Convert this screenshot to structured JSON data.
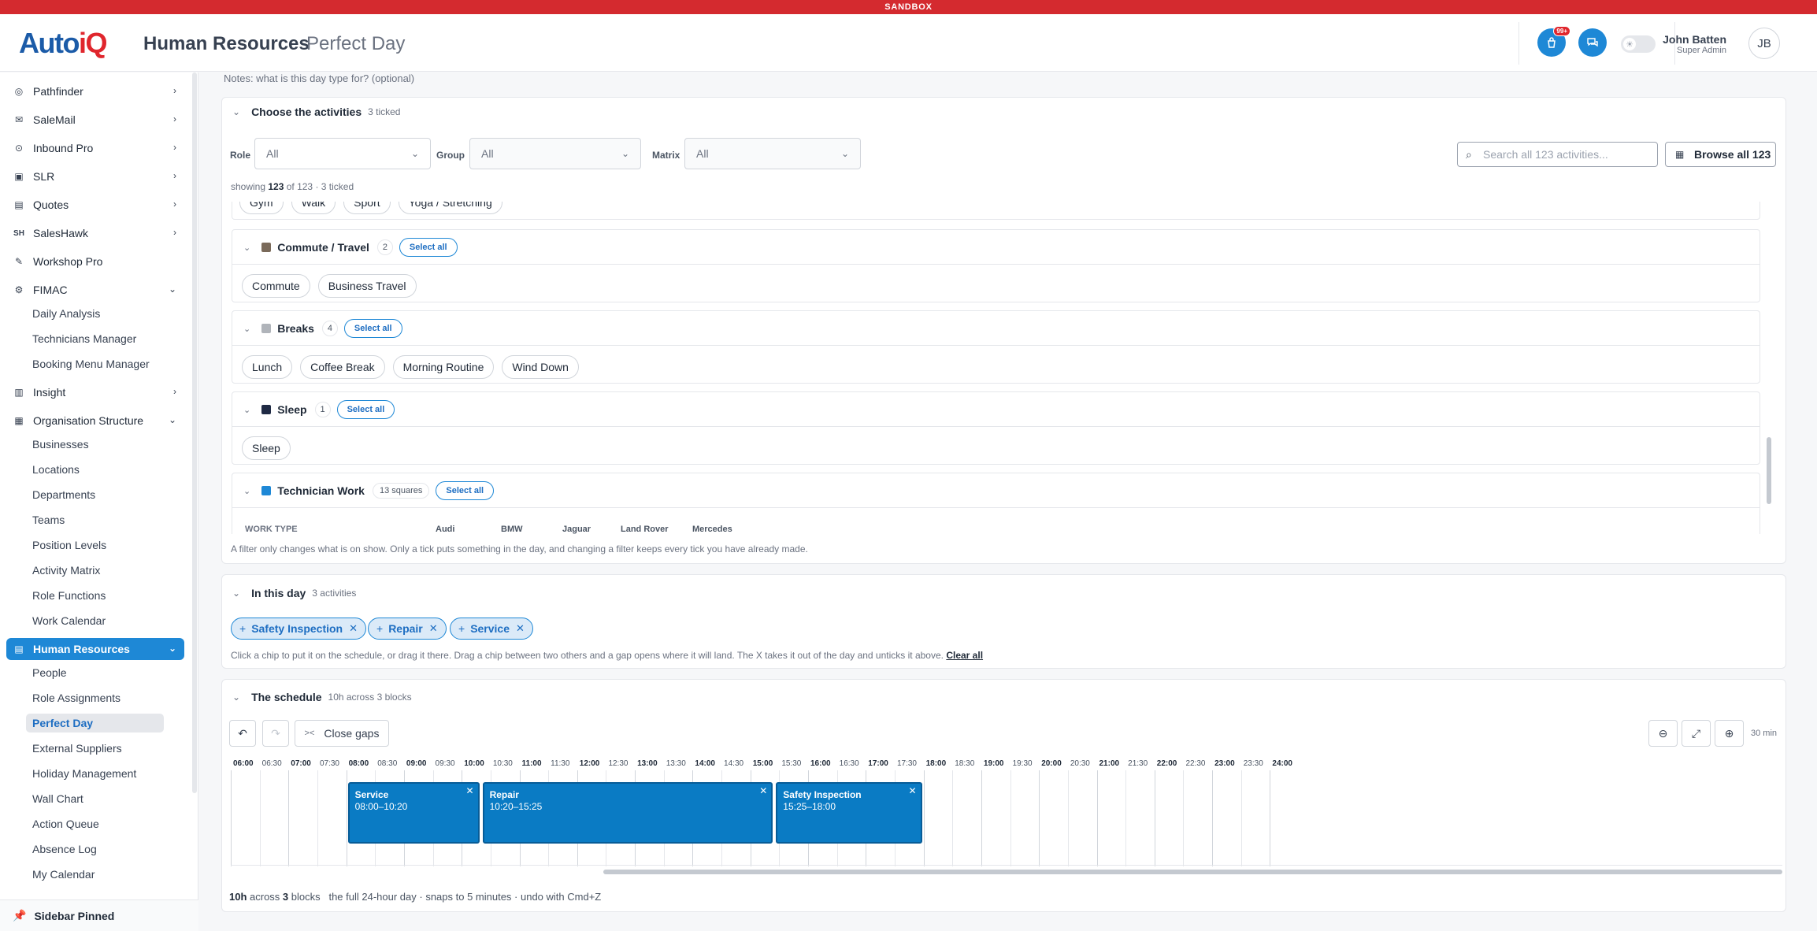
{
  "banner": "SANDBOX",
  "header": {
    "logo_a": "Auto",
    "logo_b": "iQ",
    "title": "Human Resources",
    "subtitle": "Perfect Day",
    "badge": "99+",
    "user_name": "John Batten",
    "user_role": "Super Admin",
    "avatar": "JB"
  },
  "sidebar": {
    "items": [
      {
        "label": "Pathfinder",
        "icon": "compass-icon"
      },
      {
        "label": "SaleMail",
        "icon": "salemail-icon"
      },
      {
        "label": "Inbound Pro",
        "icon": "inbound-icon"
      },
      {
        "label": "SLR",
        "icon": "slr-icon"
      },
      {
        "label": "Quotes",
        "icon": "quotes-icon"
      },
      {
        "label": "SalesHawk",
        "icon": "saleshawk-icon"
      },
      {
        "label": "Workshop Pro",
        "icon": "workshop-icon"
      },
      {
        "label": "FIMAC",
        "icon": "fimac-icon"
      },
      {
        "label": "Insight",
        "icon": "chart-icon"
      },
      {
        "label": "Organisation Structure",
        "icon": "org-icon"
      },
      {
        "label": "Human Resources",
        "icon": "hr-icon"
      }
    ],
    "fimac_sub": [
      "Daily Analysis",
      "Technicians Manager",
      "Booking Menu Manager"
    ],
    "org_sub": [
      "Businesses",
      "Locations",
      "Departments",
      "Teams",
      "Position Levels",
      "Activity Matrix",
      "Role Functions",
      "Work Calendar"
    ],
    "hr_sub": [
      "People",
      "Role Assignments",
      "Perfect Day",
      "External Suppliers",
      "Holiday Management",
      "Wall Chart",
      "Action Queue",
      "Absence Log",
      "My Calendar"
    ],
    "pinned": "Sidebar Pinned"
  },
  "notes": "Notes: what is this day type for? (optional)",
  "activities": {
    "title": "Choose the activities",
    "count": "3 ticked",
    "filters": {
      "role_label": "Role",
      "role_value": "All",
      "group_label": "Group",
      "group_value": "All",
      "matrix_label": "Matrix",
      "matrix_value": "All"
    },
    "search_placeholder": "Search all 123 activities...",
    "browse": "Browse all 123",
    "showing_pre": "showing ",
    "showing_n": "123",
    "showing_post": " of 123 · 3 ticked",
    "partial_chips": [
      "Gym",
      "Walk",
      "Sport",
      "Yoga / Stretching"
    ],
    "groups": [
      {
        "name": "Commute / Travel",
        "count": "2",
        "color": "#7a6a5a",
        "select": "Select all",
        "chips": [
          "Commute",
          "Business Travel"
        ]
      },
      {
        "name": "Breaks",
        "count": "4",
        "color": "#b0b4ba",
        "select": "Select all",
        "chips": [
          "Lunch",
          "Coffee Break",
          "Morning Routine",
          "Wind Down"
        ]
      },
      {
        "name": "Sleep",
        "count": "1",
        "color": "#1f2a44",
        "select": "Select all",
        "chips": [
          "Sleep"
        ]
      },
      {
        "name": "Technician Work",
        "count": "13 squares",
        "color": "#1e88d6",
        "select": "Select all"
      }
    ],
    "work_type_label": "WORK TYPE",
    "brands": [
      "Audi",
      "BMW",
      "Jaguar",
      "Land Rover",
      "Mercedes"
    ],
    "filter_hint": "A filter only changes what is on show. Only a tick puts something in the day, and changing a filter keeps every tick you have already made."
  },
  "in_day": {
    "title": "In this day",
    "count": "3 activities",
    "chips": [
      "Safety Inspection",
      "Repair",
      "Service"
    ],
    "hint": "Click a chip to put it on the schedule, or drag it there. Drag a chip between two others and a gap opens where it will land. The X takes it out of the day and unticks it above.",
    "clear": "Clear all"
  },
  "schedule": {
    "title": "The schedule",
    "count": "10h across 3 blocks",
    "close_gaps": "Close gaps",
    "zoom_label": "30 min",
    "ticks": [
      "06:00",
      "06:30",
      "07:00",
      "07:30",
      "08:00",
      "08:30",
      "09:00",
      "09:30",
      "10:00",
      "10:30",
      "11:00",
      "11:30",
      "12:00",
      "12:30",
      "13:00",
      "13:30",
      "14:00",
      "14:30",
      "15:00",
      "15:30",
      "16:00",
      "16:30",
      "17:00",
      "17:30",
      "18:00",
      "18:30",
      "19:00",
      "19:30",
      "20:00",
      "20:30",
      "21:00",
      "21:30",
      "22:00",
      "22:30",
      "23:00",
      "23:30",
      "24:00"
    ],
    "blocks": [
      {
        "name": "Service",
        "time": "08:00–10:20",
        "start": 8.0,
        "end": 10.333
      },
      {
        "name": "Repair",
        "time": "10:20–15:25",
        "start": 10.333,
        "end": 15.417
      },
      {
        "name": "Safety Inspection",
        "time": "15:25–18:00",
        "start": 15.417,
        "end": 18.0
      }
    ],
    "foot_total": "10h",
    "foot_across": " across ",
    "foot_blocks_n": "3",
    "foot_blocks": " blocks",
    "foot_rest": "the full 24-hour day · snaps to 5 minutes · undo with Cmd+Z"
  }
}
